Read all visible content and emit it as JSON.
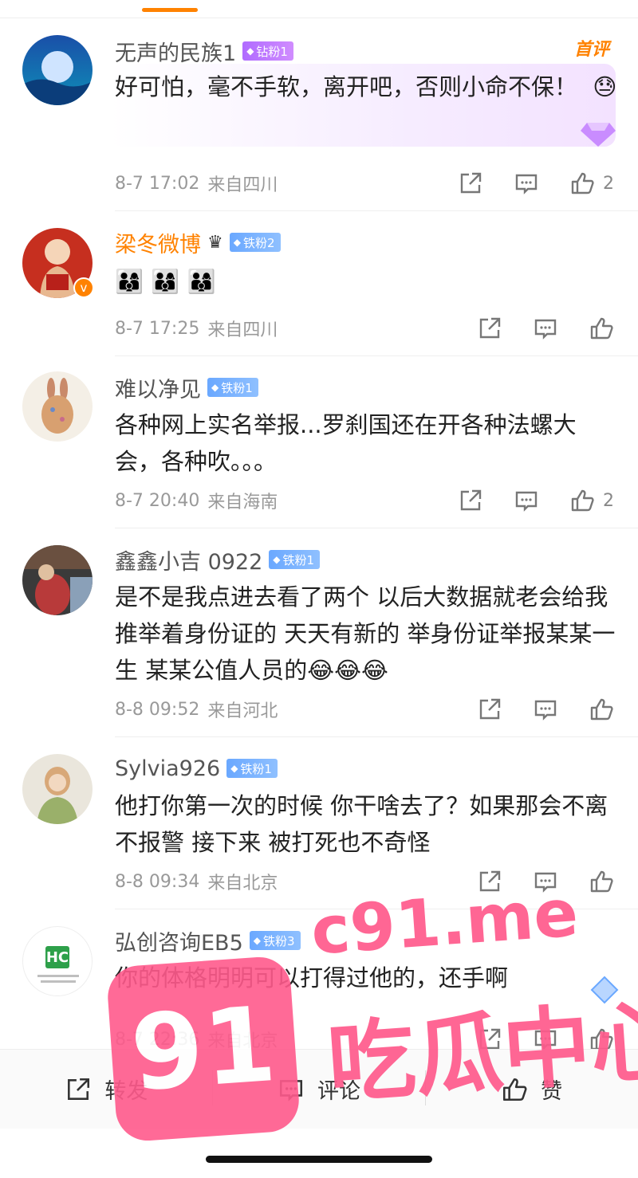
{
  "comments": [
    {
      "username": "无声的民族1",
      "badge": "钻粉1",
      "hot_tag": "首评",
      "text": "好可怕，毫不手软，离开吧，否则小命不保！",
      "emoji": "😓",
      "time": "8-7 17:02",
      "location": "来自四川",
      "likes": "2"
    },
    {
      "username": "梁冬微博",
      "badge": "铁粉2",
      "crown": "♛",
      "emoji_row": "👨‍👩‍👦 👨‍👩‍👦 👨‍👩‍👦",
      "time": "8-7 17:25",
      "location": "来自四川",
      "likes": ""
    },
    {
      "username": "难以净见",
      "badge": "铁粉1",
      "text": "各种网上实名举报...罗刹国还在开各种法螺大会，各种吹。。。",
      "time": "8-7 20:40",
      "location": "来自海南",
      "likes": "2"
    },
    {
      "username": "鑫鑫小吉 0922",
      "badge": "铁粉1",
      "text": "是不是我点进去看了两个 以后大数据就老会给我推举着身份证的 天天有新的 举身份证举报某某一生 某某公值人员的",
      "emoji": "😂😂😂",
      "time": "8-8 09:52",
      "location": "来自河北",
      "likes": ""
    },
    {
      "username": "Sylvia926",
      "badge": "铁粉1",
      "text": "他打你第一次的时候 你干啥去了？如果那会不离 不报警 接下来 被打死也不奇怪",
      "time": "8-8 09:34",
      "location": "来自北京",
      "likes": ""
    },
    {
      "username": "弘创咨询EB5",
      "badge": "铁粉3",
      "avatar_text": "HC",
      "text": "你的体格明明可以打得过他的，还手啊",
      "time": "8-7 22:36",
      "location": "来自北京",
      "likes": ""
    }
  ],
  "bottom_bar": {
    "repost": "转发",
    "comment": "评论",
    "like": "赞"
  },
  "watermark": {
    "url": "c91.me",
    "logo": "91",
    "text": "吃瓜中心"
  },
  "colors": {
    "accent": "#ff8200",
    "watermark": "#ff5a8c",
    "iron_badge": "#6aa8ff",
    "diamond_badge": "#b06bff"
  }
}
